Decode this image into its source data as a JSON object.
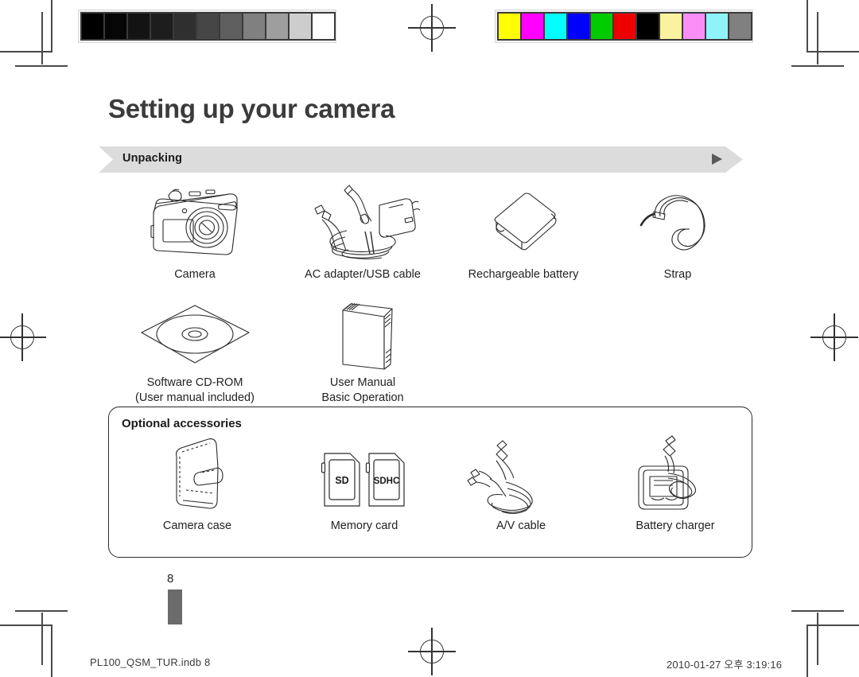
{
  "document": {
    "title": "Setting up your camera",
    "section_label": "Unpacking",
    "section_arrow_icon": "play-triangle-icon",
    "page_number": "8"
  },
  "unpacking_items": [
    {
      "icon": "camera-icon",
      "label": "Camera",
      "sublabel": ""
    },
    {
      "icon": "ac-adapter-usb-cable-icon",
      "label": "AC adapter/USB cable",
      "sublabel": ""
    },
    {
      "icon": "battery-icon",
      "label": "Rechargeable battery",
      "sublabel": ""
    },
    {
      "icon": "strap-icon",
      "label": "Strap",
      "sublabel": ""
    }
  ],
  "unpacking_items_row2": [
    {
      "icon": "cd-rom-icon",
      "label": "Software CD-ROM",
      "sublabel": "(User manual included)"
    },
    {
      "icon": "user-manual-icon",
      "label": "User Manual",
      "sublabel": "Basic Operation"
    }
  ],
  "optional_accessories": {
    "title": "Optional accessories",
    "items": [
      {
        "icon": "camera-case-icon",
        "label": "Camera case",
        "sublabel": ""
      },
      {
        "icon": "memory-card-icon",
        "label": "Memory card",
        "sublabel": ""
      },
      {
        "icon": "av-cable-icon",
        "label": "A/V cable",
        "sublabel": ""
      },
      {
        "icon": "battery-charger-icon",
        "label": "Battery charger",
        "sublabel": ""
      }
    ],
    "memory_card_labels": {
      "sd": "SD",
      "sdhc": "SDHC"
    }
  },
  "footer": {
    "left": "PL100_QSM_TUR.indb   8",
    "right": "2010-01-27   오후 3:19:16"
  },
  "calibration": {
    "grayscale_patches": [
      "#000000",
      "#060606",
      "#131313",
      "#1d1d1d",
      "#2f2f2f",
      "#464646",
      "#5f5f5f",
      "#808080",
      "#9e9e9e",
      "#cdcdcd",
      "#ffffff"
    ],
    "color_patches": [
      "#ffff00",
      "#ff00ff",
      "#00ffff",
      "#0000ff",
      "#00cc00",
      "#ee0000",
      "#000000",
      "#fbf2a0",
      "#fb8ef6",
      "#8ef4f9",
      "#808080"
    ]
  }
}
